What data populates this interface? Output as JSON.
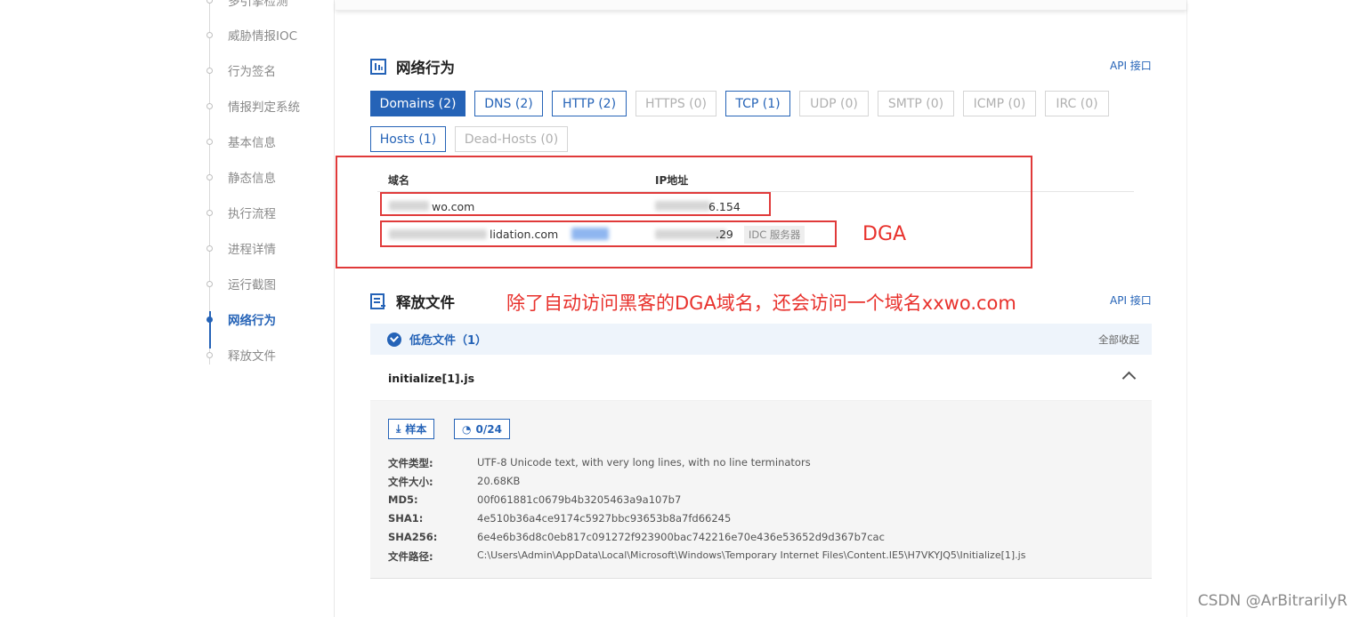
{
  "sidebar": {
    "items": [
      {
        "label": "多引擎检测",
        "active": false
      },
      {
        "label": "威胁情报IOC",
        "active": false
      },
      {
        "label": "行为签名",
        "active": false
      },
      {
        "label": "情报判定系统",
        "active": false
      },
      {
        "label": "基本信息",
        "active": false
      },
      {
        "label": "静态信息",
        "active": false
      },
      {
        "label": "执行流程",
        "active": false
      },
      {
        "label": "进程详情",
        "active": false
      },
      {
        "label": "运行截图",
        "active": false
      },
      {
        "label": "网络行为",
        "active": true
      },
      {
        "label": "释放文件",
        "active": false
      }
    ]
  },
  "network": {
    "title": "网络行为",
    "api_link": "API 接口",
    "tabs": [
      {
        "label": "Domains (2)",
        "state": "active"
      },
      {
        "label": "DNS (2)",
        "state": "enabled"
      },
      {
        "label": "HTTP (2)",
        "state": "enabled"
      },
      {
        "label": "HTTPS (0)",
        "state": "disabled"
      },
      {
        "label": "TCP (1)",
        "state": "enabled"
      },
      {
        "label": "UDP (0)",
        "state": "disabled"
      },
      {
        "label": "SMTP (0)",
        "state": "disabled"
      },
      {
        "label": "ICMP (0)",
        "state": "disabled"
      },
      {
        "label": "IRC (0)",
        "state": "disabled"
      },
      {
        "label": "Hosts (1)",
        "state": "enabled"
      },
      {
        "label": "Dead-Hosts (0)",
        "state": "disabled"
      }
    ],
    "table": {
      "columns": [
        "域名",
        "IP地址"
      ],
      "rows": [
        {
          "domain_visible": "wo.com",
          "ip_visible": "6.154",
          "badge": ""
        },
        {
          "domain_visible": "lidation.com",
          "ip_visible": ".29",
          "badge": "IDC 服务器"
        }
      ]
    }
  },
  "annotations": {
    "dga_label": "DGA",
    "note": "除了自动访问黑客的DGA域名，还会访问一个域名xxwo.com"
  },
  "release_files": {
    "title": "释放文件",
    "api_link": "API 接口",
    "group_title": "低危文件（1）",
    "collapse_all": "全部收起",
    "file": {
      "name": "initialize[1].js",
      "sample_button": "样本",
      "detect_button": "0/24",
      "details": [
        {
          "label": "文件类型:",
          "value": "UTF-8 Unicode text, with very long lines, with no line terminators"
        },
        {
          "label": "文件大小:",
          "value": "20.68KB"
        },
        {
          "label": "MD5:",
          "value": "00f061881c0679b4b3205463a9a107b7"
        },
        {
          "label": "SHA1:",
          "value": "4e510b36a4ce9174c5927bbc93653b8a7fd66245"
        },
        {
          "label": "SHA256:",
          "value": "6e4e6b36d8c0eb817c091272f923900bac742216e70e436e53652d9d367b7cac"
        },
        {
          "label": "文件路径:",
          "value": "C:\\Users\\Admin\\AppData\\Local\\Microsoft\\Windows\\Temporary Internet Files\\Content.IE5\\H7VKYJQ5\\Initialize[1].js"
        }
      ]
    }
  },
  "watermark": "CSDN @ArBitrarilyR",
  "colors": {
    "accent": "#2563b7",
    "annotation_red": "#e8312c"
  }
}
